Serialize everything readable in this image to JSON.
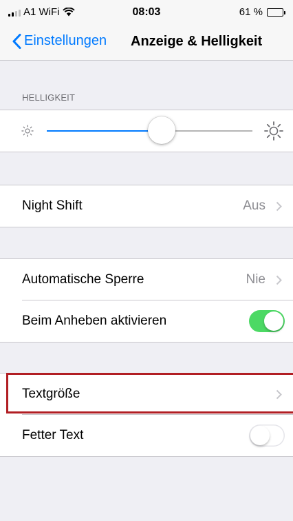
{
  "status_bar": {
    "carrier": "A1 WiFi",
    "time": "08:03",
    "battery_label": "61 %",
    "battery_level": 0.61
  },
  "nav": {
    "back_label": "Einstellungen",
    "title": "Anzeige & Helligkeit"
  },
  "brightness": {
    "header": "HELLIGKEIT",
    "level": 0.56
  },
  "rows": {
    "night_shift": {
      "label": "Night Shift",
      "value": "Aus"
    },
    "auto_lock": {
      "label": "Automatische Sperre",
      "value": "Nie"
    },
    "raise_to_wake": {
      "label": "Beim Anheben aktivieren",
      "on": true
    },
    "text_size": {
      "label": "Textgröße"
    },
    "bold_text": {
      "label": "Fetter Text",
      "on": false
    }
  },
  "colors": {
    "accent": "#007aff",
    "toggle_on": "#4cd964",
    "highlight": "#b11e23",
    "background": "#efeff4"
  }
}
